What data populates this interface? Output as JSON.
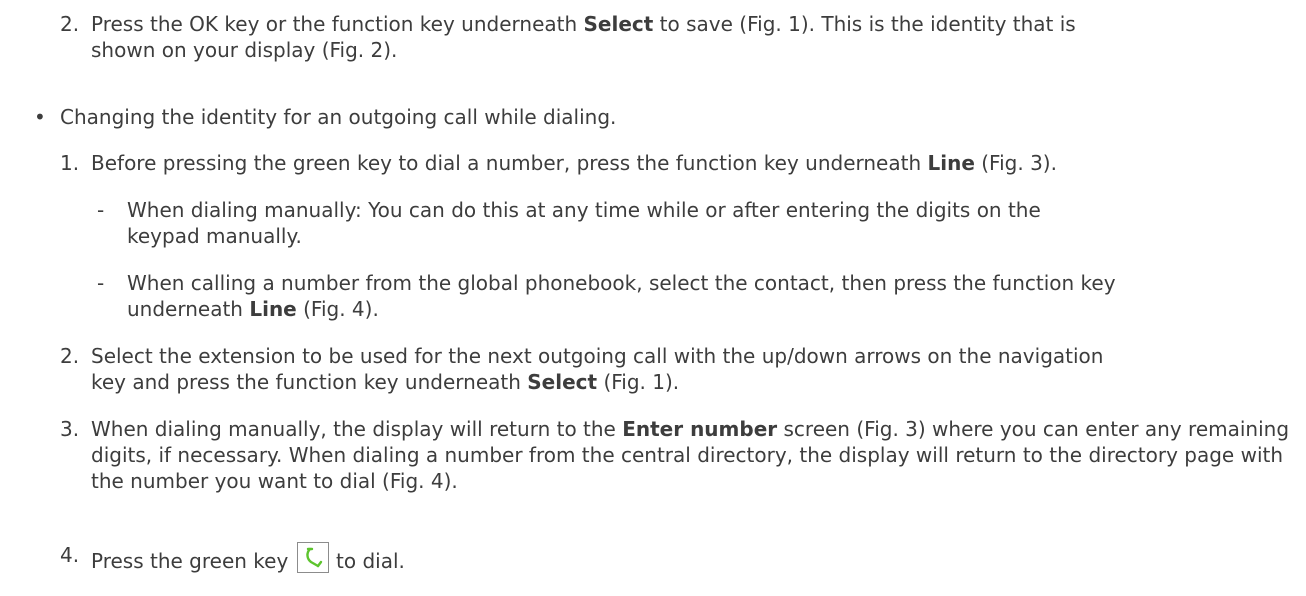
{
  "item_a": {
    "num": "2.",
    "pre": "Press the OK key or the function key underneath ",
    "bold": "Select",
    "post": " to save (Fig. 1).  This is the identity that is shown on your display (Fig. 2)."
  },
  "bullet": {
    "symbol": "•",
    "text": "Changing the identity for an outgoing call while dialing."
  },
  "step1": {
    "num": "1.",
    "pre": "Before pressing the green key to dial a number, press the function key underneath ",
    "bold": "Line",
    "post": " (Fig. 3)."
  },
  "sub1": {
    "dash": "-",
    "text": "When dialing manually:  You can do this at any time while or after entering the digits on the keypad manually."
  },
  "sub2": {
    "dash": "-",
    "pre": "When calling a number from the global phonebook, select the contact, then press the function key underneath ",
    "bold": "Line",
    "post": " (Fig. 4)."
  },
  "step2": {
    "num": "2.",
    "pre": "Select the extension to be used for the next outgoing call with the up/down arrows on the navigation key and press the function key underneath ",
    "bold": "Select",
    "post": " (Fig. 1)."
  },
  "step3": {
    "num": "3.",
    "pre": "When dialing manually, the display will return to the ",
    "bold": "Enter number",
    "post": " screen (Fig. 3) where you can enter any remaining digits, if necessary.  When dialing a number from the central directory, the display will return to the directory page with the number you want to dial (Fig. 4)."
  },
  "step4": {
    "num": "4.",
    "pre": "Press the green key ",
    "icon": "green-phone-key-icon",
    "post": " to dial."
  },
  "colors": {
    "text": "#3d3d3d",
    "key_icon": "#5dc42e",
    "key_border": "#8c8c8c"
  }
}
